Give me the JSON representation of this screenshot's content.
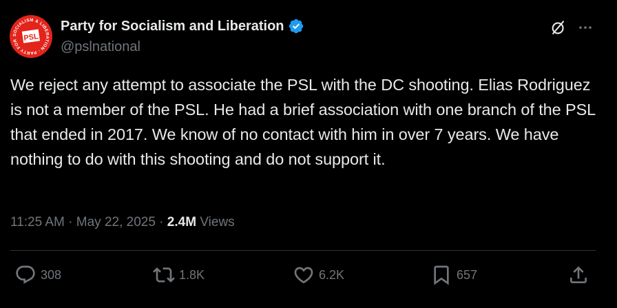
{
  "author": {
    "display_name": "Party for Socialism and Liberation",
    "handle": "@pslnational",
    "avatar": {
      "ring_text": "SOCIALISM & LIBERATION · PARTY FOR ·",
      "initials": "PSL",
      "color": "#e3241b"
    },
    "verified_color": "#1d9bf0"
  },
  "tweet": {
    "text": "We reject any attempt to associate the PSL with the DC shooting. Elias Rodriguez is not a member of the PSL. He had a brief association with one branch of the PSL that ended in 2017. We know of no contact with him in over 7 years. We have nothing to do with this shooting and do not support it."
  },
  "meta": {
    "time": "11:25 AM",
    "separator": " · ",
    "date": "May 22, 2025",
    "views_count": "2.4M",
    "views_label": " Views"
  },
  "actions": {
    "replies": "308",
    "reposts": "1.8K",
    "likes": "6.2K",
    "bookmarks": "657"
  },
  "icons": {
    "grok": "grok-icon",
    "more": "more-dots-icon",
    "reply": "reply-icon",
    "repost": "repost-icon",
    "like": "heart-icon",
    "bookmark": "bookmark-icon",
    "share": "share-icon"
  }
}
